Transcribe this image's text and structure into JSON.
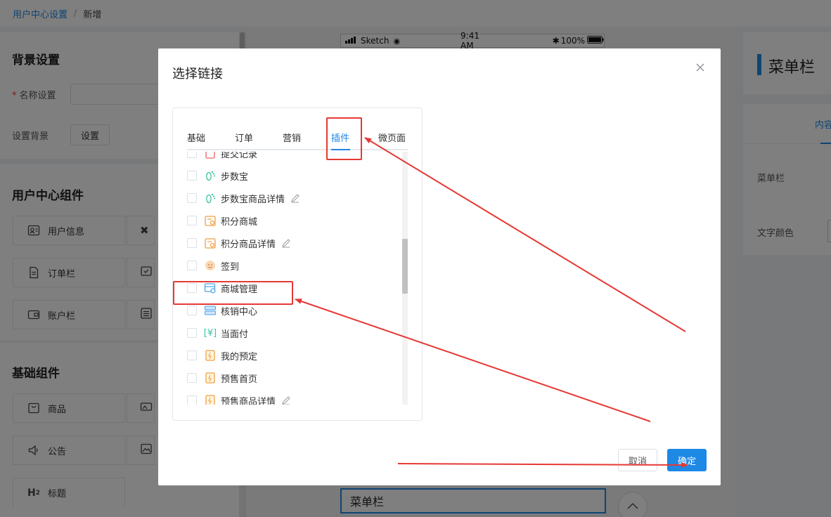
{
  "breadcrumb": {
    "parent": "用户中心设置",
    "separator": "/",
    "current": "新增"
  },
  "background_settings": {
    "title": "背景设置",
    "name_label": "名称设置",
    "required_mark": "*",
    "bg_label": "设置背景",
    "bg_button": "设置"
  },
  "user_components": {
    "title": "用户中心组件",
    "items": [
      {
        "label": "用户信息",
        "icon": "user-info-icon"
      },
      {
        "label": "订单栏",
        "icon": "order-icon"
      },
      {
        "label": "账户栏",
        "icon": "wallet-icon"
      }
    ]
  },
  "basic_components": {
    "title": "基础组件",
    "items": [
      {
        "label": "商品",
        "icon": "product-icon"
      },
      {
        "label": "公告",
        "icon": "notice-icon"
      },
      {
        "label": "标题",
        "icon": "heading-icon"
      }
    ]
  },
  "phone": {
    "carrier": "Sketch",
    "time": "9:41 AM",
    "battery": "100%"
  },
  "preview_menu": "菜单栏",
  "right_panel": {
    "title": "菜单栏",
    "tab": "内容",
    "fields": [
      "菜单栏",
      "文字颜色"
    ]
  },
  "dialog": {
    "title": "选择链接",
    "close_icon": "close-icon",
    "tabs": [
      "基础",
      "订单",
      "营销",
      "插件",
      "微页面"
    ],
    "active_tab": "插件",
    "items": [
      {
        "label": "提交记录",
        "icon": "record-icon",
        "editable": false,
        "partial": "top"
      },
      {
        "label": "步数宝",
        "icon": "footprint-icon",
        "editable": false
      },
      {
        "label": "步数宝商品详情",
        "icon": "footprint-icon",
        "editable": true
      },
      {
        "label": "积分商城",
        "icon": "points-mall-icon",
        "editable": false
      },
      {
        "label": "积分商品详情",
        "icon": "points-mall-icon",
        "editable": true
      },
      {
        "label": "签到",
        "icon": "checkin-icon",
        "editable": false
      },
      {
        "label": "商城管理",
        "icon": "mall-manage-icon",
        "editable": false
      },
      {
        "label": "核销中心",
        "icon": "verify-center-icon",
        "editable": false
      },
      {
        "label": "当面付",
        "icon": "face-pay-icon",
        "editable": false
      },
      {
        "label": "我的预定",
        "icon": "reservation-icon",
        "editable": false
      },
      {
        "label": "预售首页",
        "icon": "presale-icon",
        "editable": false
      },
      {
        "label": "预售商品详情",
        "icon": "presale-icon",
        "editable": true,
        "partial": "bottom"
      }
    ],
    "cancel_label": "取消",
    "confirm_label": "确定"
  },
  "colors": {
    "accent": "#1e88e5",
    "annotation": "#e53935"
  }
}
